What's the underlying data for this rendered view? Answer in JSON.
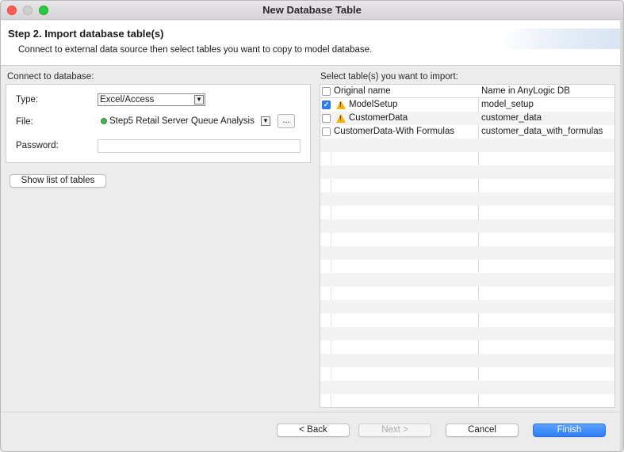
{
  "window": {
    "title": "New Database Table"
  },
  "header": {
    "step_title": "Step 2. Import database table(s)",
    "description": "Connect to external data source then select tables you want to copy to model database."
  },
  "connect": {
    "section_label": "Connect to database:",
    "type_label": "Type:",
    "type_value": "Excel/Access",
    "file_label": "File:",
    "file_value": "Step5 Retail Server Queue Analysis",
    "browse_label": "...",
    "password_label": "Password:",
    "password_value": "",
    "show_tables_label": "Show list of tables"
  },
  "tables": {
    "section_label": "Select table(s) you want to import:",
    "columns": [
      "Original name",
      "Name in AnyLogic DB"
    ],
    "rows": [
      {
        "original": "ModelSetup",
        "anylogic": "model_setup",
        "checked": true,
        "warning": true
      },
      {
        "original": "CustomerData",
        "anylogic": "customer_data",
        "checked": false,
        "warning": true
      },
      {
        "original": "CustomerData-With Formulas",
        "anylogic": "customer_data_with_formulas",
        "checked": false,
        "warning": false
      }
    ]
  },
  "footer": {
    "back_label": "< Back",
    "next_label": "Next >",
    "cancel_label": "Cancel",
    "finish_label": "Finish"
  },
  "colors": {
    "accent": "#2d7ef7",
    "warning": "#f5b400",
    "file_status": "#49b14b"
  },
  "icons": [
    "close-traffic-light",
    "minimize-traffic-light",
    "maximize-traffic-light",
    "warning-icon",
    "status-dot-icon",
    "dropdown-arrow-icon",
    "check-icon"
  ]
}
